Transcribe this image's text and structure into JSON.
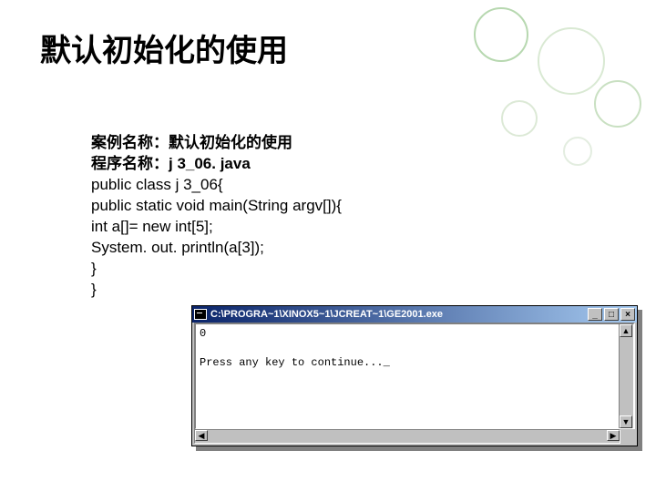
{
  "title": "默认初始化的使用",
  "box": {
    "line1": "案例名称：默认初始化的使用",
    "line2": "程序名称：j 3_06. java",
    "code": "public class j 3_06{\npublic static void main(String argv[]){\nint a[]= new int[5];\nSystem. out. println(a[3]);\n}\n}"
  },
  "console": {
    "title": "C:\\PROGRA~1\\XINOX5~1\\JCREAT~1\\GE2001.exe",
    "output": "0\n\nPress any key to continue..._",
    "buttons": {
      "min": "_",
      "max": "□",
      "close": "×"
    },
    "arrows": {
      "up": "▲",
      "down": "▼",
      "left": "◀",
      "right": "▶"
    }
  }
}
